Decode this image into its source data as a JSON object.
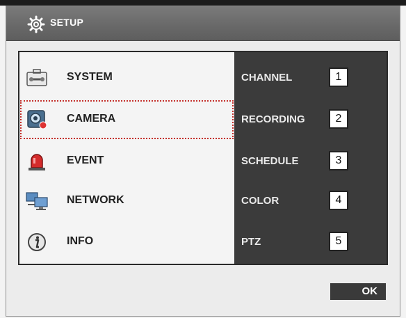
{
  "window": {
    "title": "SETUP",
    "title_icon": "gear-icon"
  },
  "menu": {
    "items": [
      {
        "label": "SYSTEM",
        "icon": "toolbox-icon"
      },
      {
        "label": "CAMERA",
        "icon": "camera-icon",
        "selected": true
      },
      {
        "label": "EVENT",
        "icon": "alarm-light-icon"
      },
      {
        "label": "NETWORK",
        "icon": "network-icon"
      },
      {
        "label": "INFO",
        "icon": "info-icon"
      }
    ]
  },
  "submenu": {
    "items": [
      {
        "label": "CHANNEL",
        "number": "1"
      },
      {
        "label": "RECORDING",
        "number": "2"
      },
      {
        "label": "SCHEDULE",
        "number": "3"
      },
      {
        "label": "COLOR",
        "number": "4"
      },
      {
        "label": "PTZ",
        "number": "5"
      }
    ]
  },
  "buttons": {
    "ok_label": "OK"
  },
  "colors": {
    "selection_outline": "#c4302b",
    "submenu_bg": "#3b3b3b",
    "titlebar_bg": "#6e6e6e"
  }
}
